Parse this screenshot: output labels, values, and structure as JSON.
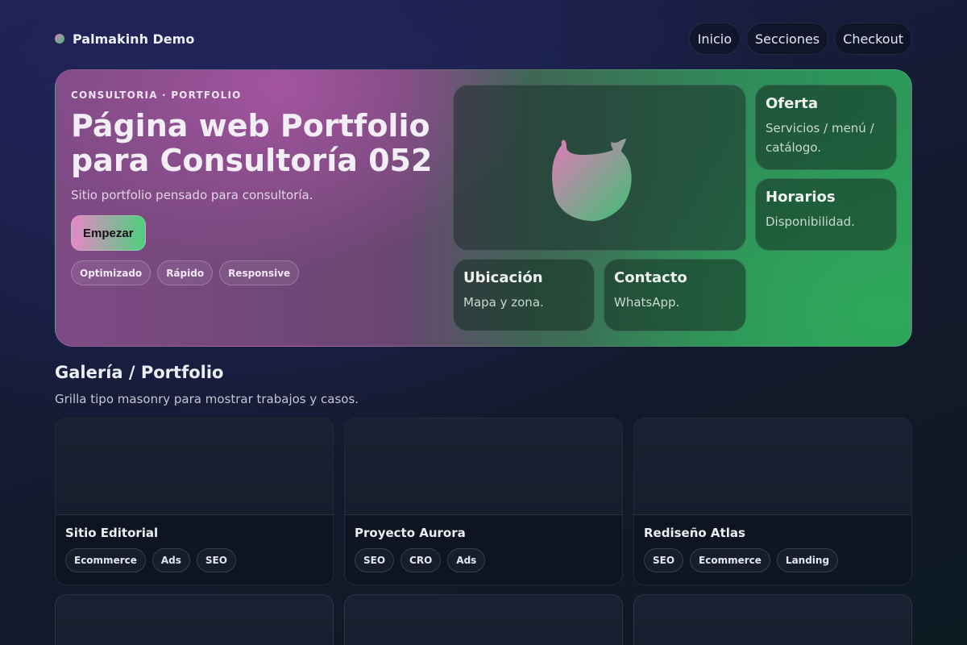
{
  "header": {
    "brand": "Palmakinh Demo",
    "nav": [
      "Inicio",
      "Secciones",
      "Checkout"
    ]
  },
  "hero": {
    "eyebrow": "CONSULTORIA · PORTFOLIO",
    "title_line1": "Página web Portfolio",
    "title_line2": "para Consultoría 052",
    "subtitle": "Sitio portfolio pensado para consultoría.",
    "cta": "Empezar",
    "chips": [
      "Optimizado",
      "Rápido",
      "Responsive"
    ],
    "tiles": {
      "oferta": {
        "title": "Oferta",
        "text": "Servicios / menú / catálogo."
      },
      "horarios": {
        "title": "Horarios",
        "text": "Disponibilidad."
      },
      "ubicacion": {
        "title": "Ubicación",
        "text": "Mapa y zona."
      },
      "contacto": {
        "title": "Contacto",
        "text": "WhatsApp."
      }
    },
    "logo_icon": "cat-blob-logo-icon"
  },
  "gallery": {
    "title": "Galería / Portfolio",
    "subtitle": "Grilla tipo masonry para mostrar trabajos y casos.",
    "cards": [
      {
        "title": "Sitio Editorial",
        "tags": [
          "Ecommerce",
          "Ads",
          "SEO"
        ]
      },
      {
        "title": "Proyecto Aurora",
        "tags": [
          "SEO",
          "CRO",
          "Ads"
        ]
      },
      {
        "title": "Rediseño Atlas",
        "tags": [
          "SEO",
          "Ecommerce",
          "Landing"
        ]
      }
    ]
  },
  "colors": {
    "accent_pink": "#e588c6",
    "accent_green": "#4ed07d",
    "background": "#141a36"
  }
}
